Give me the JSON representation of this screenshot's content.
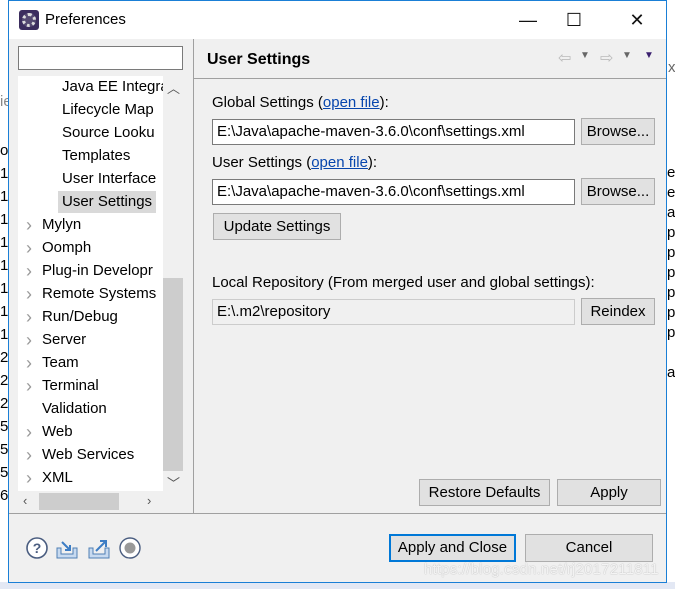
{
  "window": {
    "title": "Preferences",
    "minimize": "—",
    "maximize": "☐",
    "close": "✕"
  },
  "filter": {
    "value": "",
    "placeholder": ""
  },
  "tree": {
    "children": [
      "Java EE Integra",
      "Lifecycle Map",
      "Source Looku",
      "Templates",
      "User Interface",
      "User Settings"
    ],
    "selected": "User Settings",
    "top": [
      {
        "label": "Mylyn",
        "expandable": true
      },
      {
        "label": "Oomph",
        "expandable": true
      },
      {
        "label": "Plug-in Developr",
        "expandable": true
      },
      {
        "label": "Remote Systems",
        "expandable": true
      },
      {
        "label": "Run/Debug",
        "expandable": true
      },
      {
        "label": "Server",
        "expandable": true
      },
      {
        "label": "Team",
        "expandable": true
      },
      {
        "label": "Terminal",
        "expandable": true
      },
      {
        "label": "Validation",
        "expandable": false
      },
      {
        "label": "Web",
        "expandable": true
      },
      {
        "label": "Web Services",
        "expandable": true
      },
      {
        "label": "XML",
        "expandable": true
      }
    ]
  },
  "page": {
    "title": "User Settings",
    "global_label": "Global Settings (",
    "global_label_end": "):",
    "open_file": "open file",
    "global_value": "E:\\Java\\apache-maven-3.6.0\\conf\\settings.xml",
    "user_label": "User Settings (",
    "user_label_end": "):",
    "user_value": "E:\\Java\\apache-maven-3.6.0\\conf\\settings.xml",
    "browse": "Browse...",
    "update": "Update Settings",
    "local_label": "Local Repository (From merged user and global settings):",
    "local_value": "E:\\.m2\\repository",
    "reindex": "Reindex",
    "restore": "Restore Defaults",
    "apply": "Apply"
  },
  "footer": {
    "apply_close": "Apply and Close",
    "cancel": "Cancel"
  },
  "watermark": "https://blog.csdn.net/rj2017211811",
  "background": {
    "left_top": "ie",
    "left": [
      "o",
      "1",
      "1",
      "1",
      "1",
      "1",
      "1",
      "1",
      "1",
      "2",
      "2",
      "2",
      "5",
      "5",
      "5",
      "6"
    ],
    "right": [
      "e",
      "e",
      "a",
      "p",
      "p",
      "p",
      "p",
      "p",
      "p",
      "",
      "a"
    ],
    "right_top": "x"
  },
  "colors": {
    "accent": "#1a7fd6",
    "link": "#0645ad",
    "selection": "#d9d9d9"
  }
}
